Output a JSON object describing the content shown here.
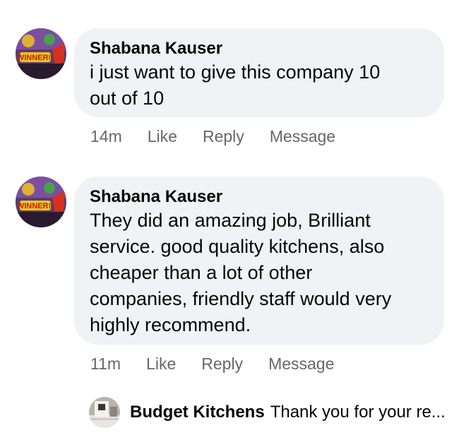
{
  "comments": [
    {
      "author": "Shabana Kauser",
      "text_lines": [
        "i just want to give this company 10",
        "out of 10"
      ],
      "time": "14m",
      "like": "Like",
      "reply": "Reply",
      "message": "Message",
      "avatar_badge": "WINNER!"
    },
    {
      "author": "Shabana Kauser",
      "text_lines": [
        "They did an amazing job,  Brilliant",
        "service.  good quality kitchens, also",
        "cheaper than a lot of other",
        "companies, friendly staff would very",
        "highly recommend."
      ],
      "time": "11m",
      "like": "Like",
      "reply": "Reply",
      "message": "Message",
      "avatar_badge": "WINNER!"
    }
  ],
  "reply_preview": {
    "author": "Budget Kitchens",
    "text": "Thank you for your re..."
  },
  "colors": {
    "bubble": "#f0f2f5",
    "meta_text": "#65676b",
    "text": "#050505"
  },
  "icons": [
    "profile-avatar-icon",
    "business-avatar-icon"
  ]
}
